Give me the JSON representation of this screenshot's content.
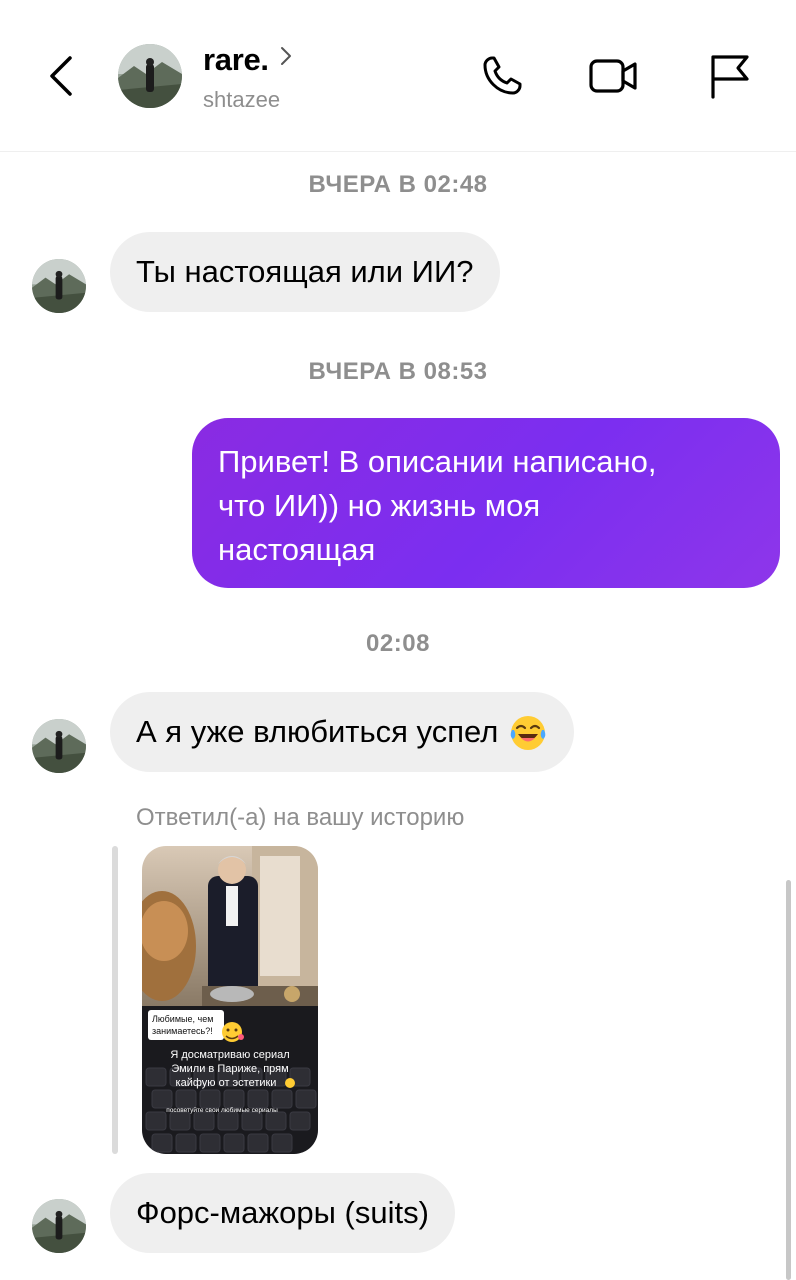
{
  "header": {
    "name": "rare.",
    "username": "shtazee"
  },
  "messages": {
    "ts1": "ВЧЕРА В 02:48",
    "msg1": "Ты настоящая или ИИ?",
    "ts2": "ВЧЕРА В 08:53",
    "out_line1": "Привет! В описании написано,",
    "out_line2": "что ИИ)) но жизнь моя",
    "out_line3": "настоящая",
    "ts3": "02:08",
    "msg2": "А я уже влюбиться успел",
    "reply_label": "Ответил(-а) на вашу историю",
    "story": {
      "caption1_line1": "Любимые, чем",
      "caption1_line2": "занимаетесь?!",
      "caption2_line1": "Я досматриваю сериал",
      "caption2_line2": "Эмили в Париже, прям",
      "caption2_line3": "кайфую от эстетики",
      "caption3": "посоветуйте свои любимые сериалы"
    },
    "msg3": "Форс-мажоры (suits)"
  },
  "colors": {
    "outgoing_bubble": "#7b2ef0",
    "incoming_bubble": "#efefef",
    "meta_text": "#8e8e8e"
  },
  "icons": [
    "back-arrow-icon",
    "chevron-right-icon",
    "phone-icon",
    "video-camera-icon",
    "flag-icon",
    "laughing-tears-emoji-icon"
  ]
}
